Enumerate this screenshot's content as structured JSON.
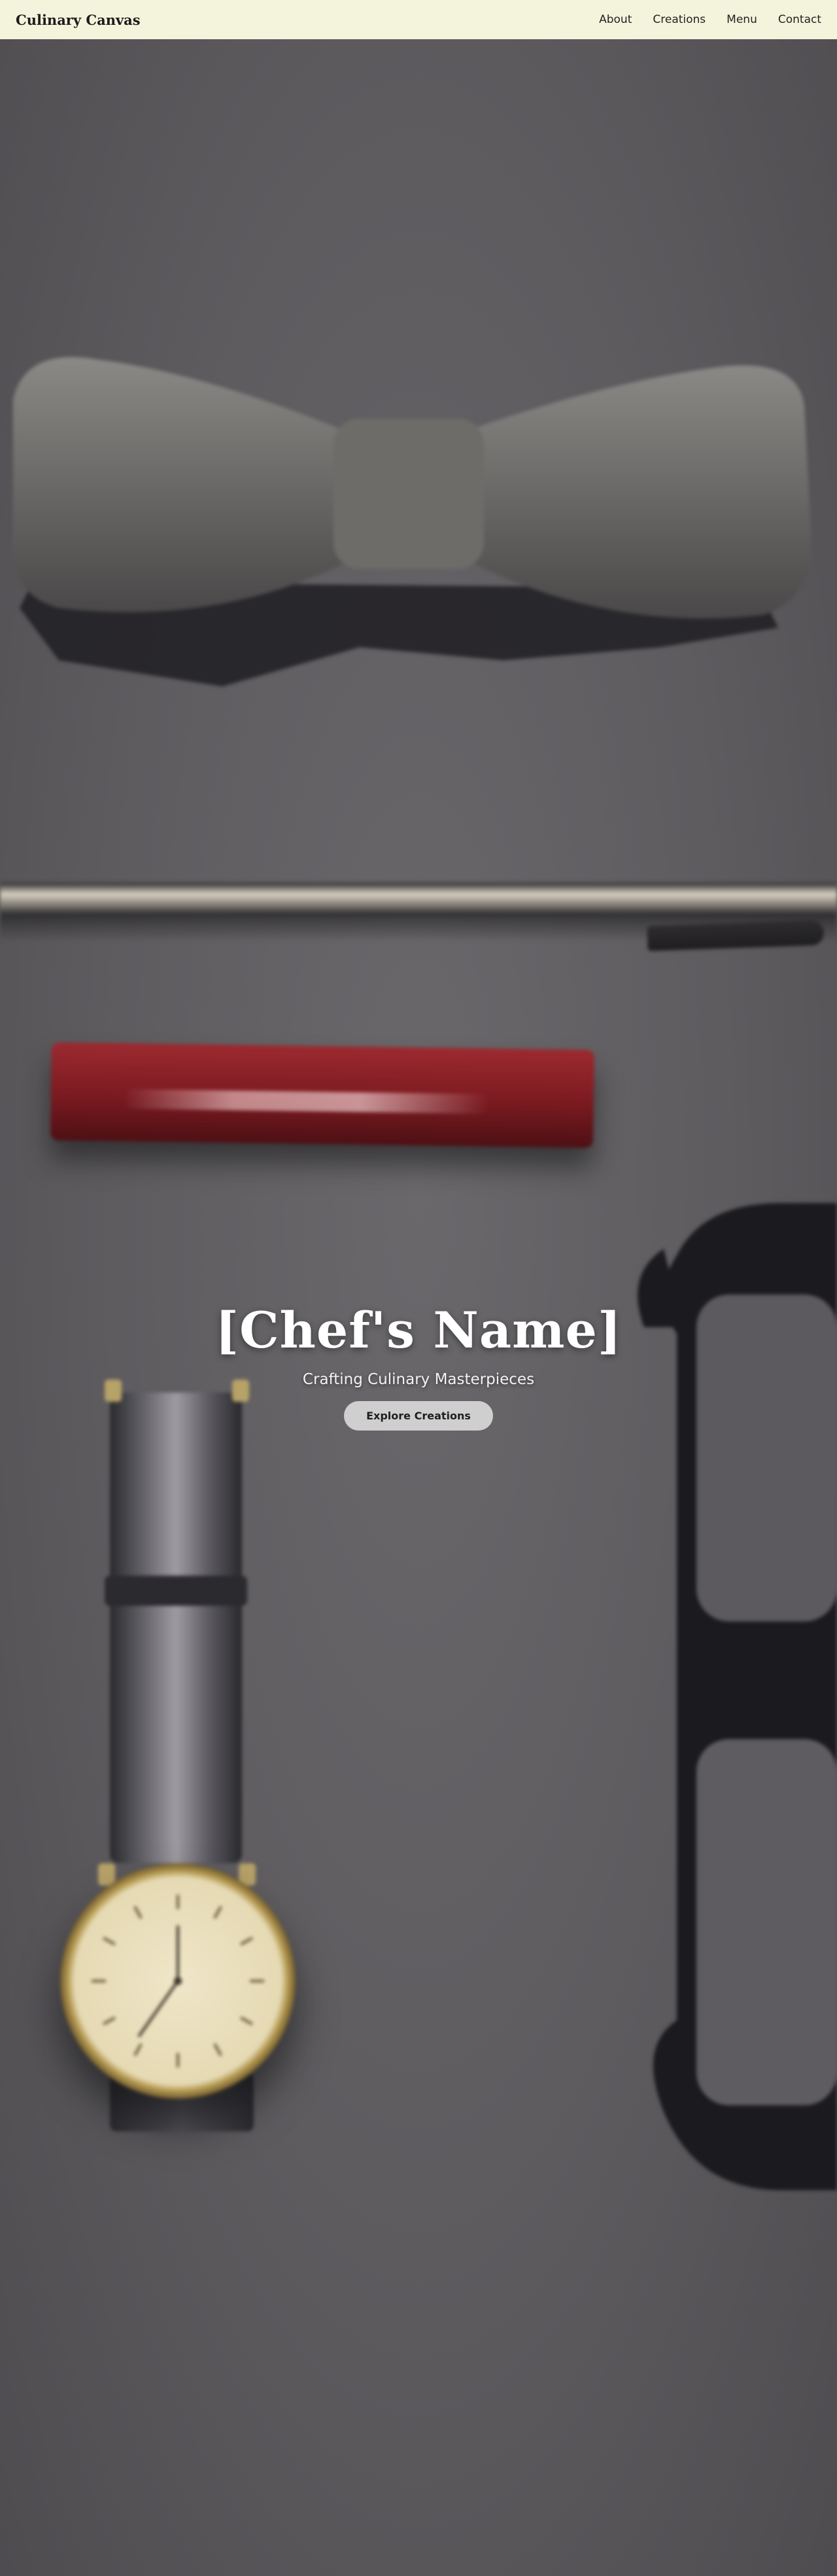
{
  "header": {
    "brand": "Culinary Canvas",
    "nav": [
      "About",
      "Creations",
      "Menu",
      "Contact"
    ]
  },
  "hero": {
    "title": "[Chef's Name]",
    "subtitle": "Crafting Culinary Masterpieces",
    "cta_label": "Explore Creations"
  },
  "colors": {
    "header_bg": "#f4f4dc",
    "hero_bg": "#5f5d60",
    "button_bg": "#cfcfcf",
    "title_text": "#ffffff"
  }
}
